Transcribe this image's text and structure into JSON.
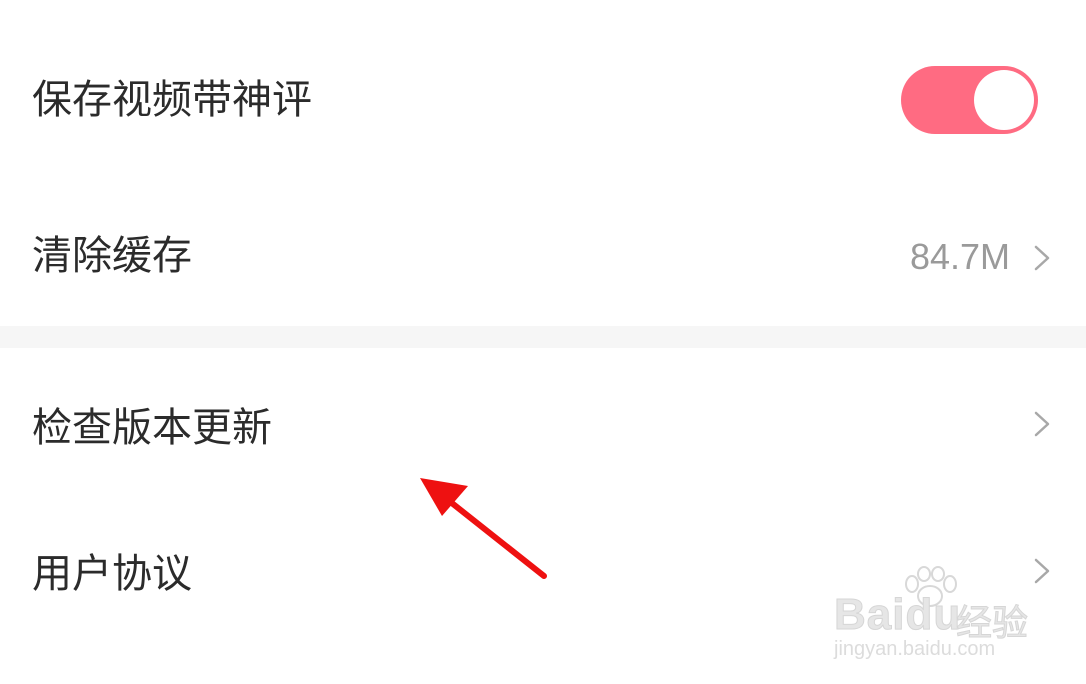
{
  "settings": {
    "save_video": {
      "label": "保存视频带神评",
      "toggle_on": true,
      "toggle_color": "#ff6b82"
    },
    "clear_cache": {
      "label": "清除缓存",
      "value": "84.7M"
    },
    "check_update": {
      "label": "检查版本更新"
    },
    "user_agreement": {
      "label": "用户协议"
    }
  },
  "icons": {
    "chevron": "chevron-right-icon",
    "arrow": "annotation-arrow-icon",
    "paw": "paw-icon"
  },
  "annotation": {
    "arrow_color": "#ee1111"
  },
  "watermark": {
    "brand": "Bai",
    "brand_du": "du",
    "suffix": "经验",
    "url": "jingyan.baidu.com"
  }
}
